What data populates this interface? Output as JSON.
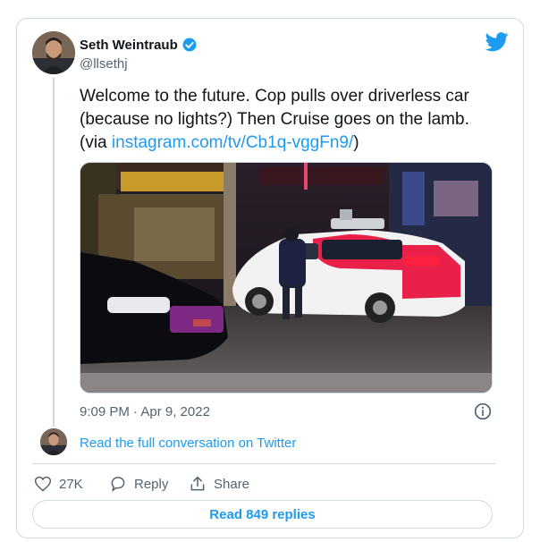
{
  "author": {
    "name": "Seth Weintraub",
    "handle": "@llsethj"
  },
  "tweet": {
    "text_before_link": "Welcome to the future. Cop pulls over driverless car (because no lights?) Then Cruise goes on the lamb. (via ",
    "link_text": "instagram.com/tv/Cb1q-vggFn9/",
    "text_after_link": ")",
    "timestamp": "9:09 PM · Apr 9, 2022"
  },
  "conversation_link": "Read the full conversation on Twitter",
  "actions": {
    "like_count": "27K",
    "reply_label": "Reply",
    "share_label": "Share"
  },
  "read_replies_label": "Read 849 replies",
  "colors": {
    "accent": "#1d9bf0",
    "verified": "#1d9bf0",
    "text": "#0f1419",
    "secondary": "#536471",
    "border": "#cfd9de"
  },
  "icons": [
    "verified-badge-icon",
    "twitter-bird-icon",
    "info-icon",
    "heart-icon",
    "reply-bubble-icon",
    "share-icon"
  ]
}
